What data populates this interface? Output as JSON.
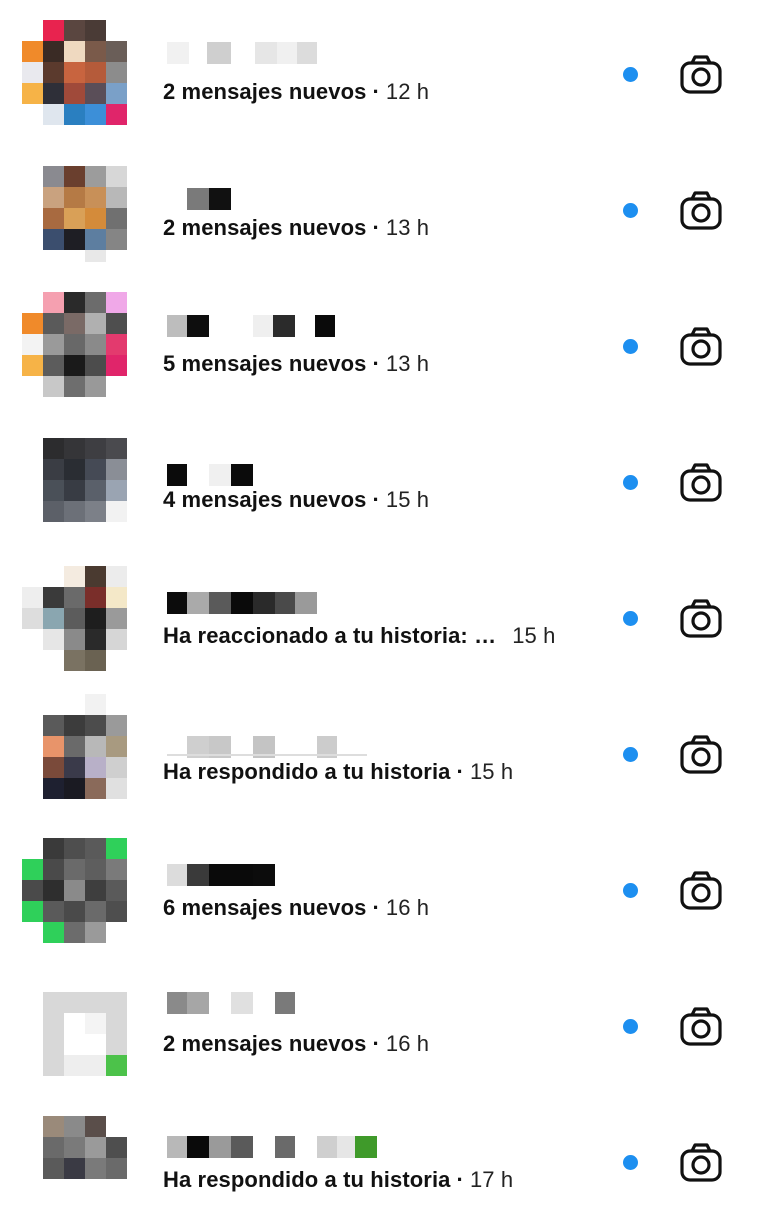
{
  "colors": {
    "unread_dot": "#1d8ff0",
    "text": "#111111"
  },
  "icons": {
    "camera": "camera-icon"
  },
  "conversations": [
    {
      "preview": "2 mensajes nuevos",
      "separator": "·",
      "time": "12 h",
      "unread": true
    },
    {
      "preview": "2 mensajes nuevos",
      "separator": "·",
      "time": "13 h",
      "unread": true
    },
    {
      "preview": "5 mensajes nuevos",
      "separator": "·",
      "time": "13 h",
      "unread": true
    },
    {
      "preview": "4 mensajes nuevos",
      "separator": "·",
      "time": "15 h",
      "unread": true
    },
    {
      "preview": "Ha reaccionado a tu historia: …",
      "separator": "",
      "time": "15 h",
      "unread": true
    },
    {
      "preview": "Ha respondido a tu historia",
      "separator": "·",
      "time": "15 h",
      "unread": true
    },
    {
      "preview": "6 mensajes nuevos",
      "separator": "·",
      "time": "16 h",
      "unread": true
    },
    {
      "preview": "2 mensajes nuevos",
      "separator": "·",
      "time": "16 h",
      "unread": true
    },
    {
      "preview": "Ha respondido a tu historia",
      "separator": "·",
      "time": "17 h",
      "unread": true
    }
  ]
}
